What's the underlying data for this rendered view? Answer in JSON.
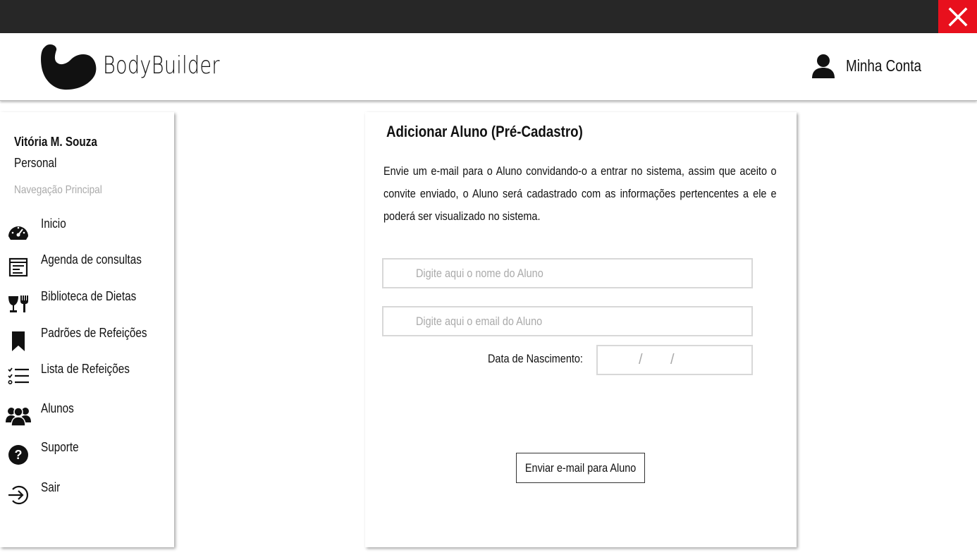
{
  "app": {
    "logo_text": "BodyBuilder",
    "account_label": "Minha Conta",
    "close_icon": "close-icon"
  },
  "sidebar": {
    "user_name": "Vitória M. Souza",
    "user_role": "Personal",
    "nav_caption": "Navegação Principal",
    "items": [
      {
        "label": "Inicio",
        "icon": "speedometer-icon"
      },
      {
        "label": "Agenda de consultas",
        "icon": "calendar-icon"
      },
      {
        "label": "Biblioteca de Dietas",
        "icon": "utensils-icon"
      },
      {
        "label": "Padrões de Refeições",
        "icon": "bookmark-icon"
      },
      {
        "label": "Lista de Refeições",
        "icon": "checklist-icon"
      },
      {
        "label": "Alunos",
        "icon": "users-icon"
      },
      {
        "label": "Suporte",
        "icon": "help-icon"
      },
      {
        "label": "Sair",
        "icon": "logout-icon"
      }
    ]
  },
  "main": {
    "title": "Adicionar Aluno (Pré-Cadastro)",
    "description": "Envie um e-mail para o Aluno convidando-o a entrar no sistema, assim que aceito o convite enviado, o Aluno será cadastrado com as informações pertencentes a ele e poderá ser visualizado no sistema.",
    "name_placeholder": "Digite aqui o nome do Aluno",
    "email_placeholder": "Digite aqui o email do Aluno",
    "birth_label": "Data de Nascimento:",
    "date_separator": "/",
    "send_button": "Enviar e-mail para Aluno"
  },
  "colors": {
    "topbar": "#272727",
    "close": "#e8101d"
  }
}
